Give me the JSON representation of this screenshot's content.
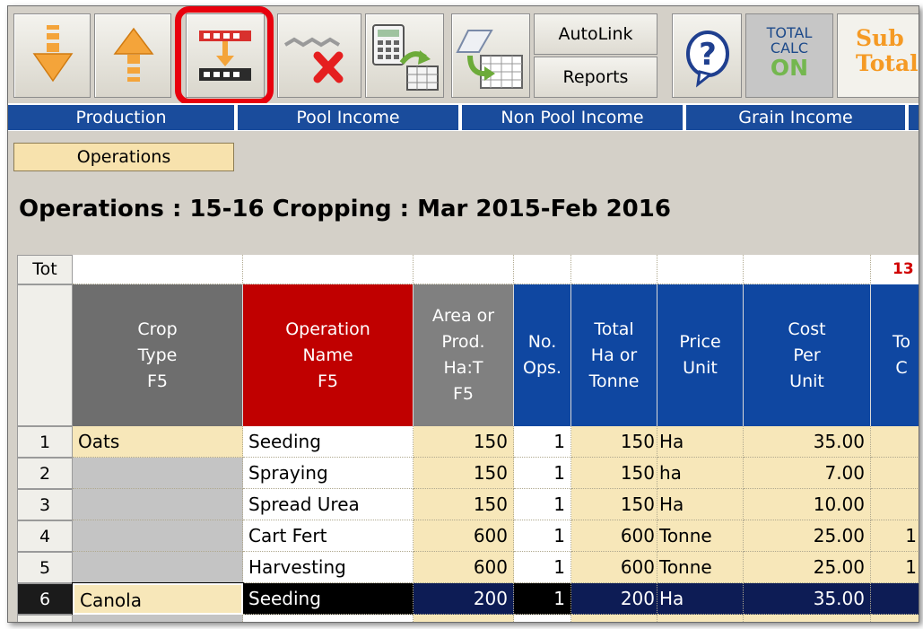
{
  "toolbar": {
    "buttons": [
      {
        "name": "move-down-button",
        "icon": "arrow-down-icon"
      },
      {
        "name": "move-up-button",
        "icon": "arrow-up-icon"
      },
      {
        "name": "insert-row-button",
        "icon": "insert-row-icon",
        "highlighted": true
      },
      {
        "name": "delete-row-button",
        "icon": "delete-row-icon"
      },
      {
        "name": "copy-calculator-button",
        "icon": "calculator-copy-icon"
      },
      {
        "name": "link-spreadsheet-button",
        "icon": "spreadsheet-link-icon"
      },
      {
        "name": "help-button",
        "icon": "question-icon"
      }
    ],
    "autolink_label": "AutoLink",
    "reports_label": "Reports",
    "total_calc_line1": "TOTAL",
    "total_calc_line2": "CALC",
    "total_calc_line3": "ON",
    "sub_total_line1": "Sub",
    "sub_total_line2": "Total"
  },
  "nav_tabs": [
    "Production",
    "Pool Income",
    "Non Pool Income",
    "Grain Income"
  ],
  "sub_tab": "Operations",
  "page_title": "Operations : 15-16  Cropping : Mar 2015-Feb 2016",
  "grid": {
    "tot_label": "Tot",
    "tot_partial_value": "13",
    "columns": [
      {
        "key": "crop",
        "label": "Crop\nType\nF5",
        "color": "#6e6e6e"
      },
      {
        "key": "operation",
        "label": "Operation\nName\nF5",
        "color": "#c00000"
      },
      {
        "key": "area",
        "label": "Area or\nProd.\nHa:T\nF5",
        "color": "#808080"
      },
      {
        "key": "ops",
        "label": "No.\nOps.",
        "color": "#0f47a1"
      },
      {
        "key": "total",
        "label": "Total\nHa or\nTonne",
        "color": "#0f47a1"
      },
      {
        "key": "unit",
        "label": "Price\nUnit",
        "color": "#0f47a1"
      },
      {
        "key": "cost",
        "label": "Cost\nPer\nUnit",
        "color": "#0f47a1"
      },
      {
        "key": "totalcost",
        "label": "To\nC",
        "color": "#0f47a1"
      }
    ],
    "rows": [
      {
        "n": "1",
        "crop": "Oats",
        "operation": "Seeding",
        "area": "150",
        "ops": "1",
        "total": "150",
        "unit": "Ha",
        "cost": "35.00",
        "totalcost": ""
      },
      {
        "n": "2",
        "crop": "",
        "operation": "Spraying",
        "area": "150",
        "ops": "1",
        "total": "150",
        "unit": "ha",
        "cost": "7.00",
        "totalcost": ""
      },
      {
        "n": "3",
        "crop": "",
        "operation": "Spread Urea",
        "area": "150",
        "ops": "1",
        "total": "150",
        "unit": "Ha",
        "cost": "10.00",
        "totalcost": ""
      },
      {
        "n": "4",
        "crop": "",
        "operation": "Cart Fert",
        "area": "600",
        "ops": "1",
        "total": "600",
        "unit": "Tonne",
        "cost": "25.00",
        "totalcost": "1"
      },
      {
        "n": "5",
        "crop": "",
        "operation": "Harvesting",
        "area": "600",
        "ops": "1",
        "total": "600",
        "unit": "Tonne",
        "cost": "25.00",
        "totalcost": "1"
      },
      {
        "n": "6",
        "crop": "Canola",
        "operation": "Seeding",
        "area": "200",
        "ops": "1",
        "total": "200",
        "unit": "Ha",
        "cost": "35.00",
        "totalcost": "",
        "selected": true
      }
    ]
  }
}
